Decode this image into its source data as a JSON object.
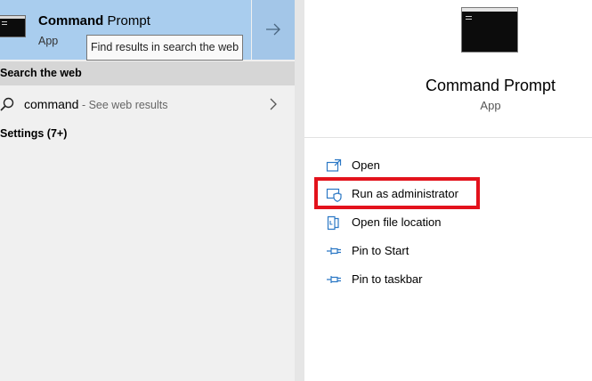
{
  "best_match": {
    "title_bold": "Command",
    "title_rest": " Prompt",
    "subtitle": "App",
    "icon": "command-prompt-icon",
    "tooltip": "Find results in search the web",
    "arrow_icon": "arrow-right-icon"
  },
  "web_section": {
    "header": "Search the web",
    "query": "command",
    "hint": " - See web results",
    "search_icon": "search-icon",
    "chevron_icon": "chevron-right-icon"
  },
  "settings_section": {
    "header": "Settings (7+)"
  },
  "preview": {
    "title": "Command Prompt",
    "subtitle": "App",
    "icon": "command-prompt-icon"
  },
  "actions": [
    {
      "label": "Open",
      "icon": "open-icon"
    },
    {
      "label": "Run as administrator",
      "icon": "shield-icon"
    },
    {
      "label": "Open file location",
      "icon": "file-location-icon"
    },
    {
      "label": "Pin to Start",
      "icon": "pin-icon"
    },
    {
      "label": "Pin to taskbar",
      "icon": "pin-icon"
    }
  ],
  "colors": {
    "accent_icon": "#2b78c5",
    "selected_background": "#a9cdee",
    "highlight_outline": "#e3121c"
  }
}
